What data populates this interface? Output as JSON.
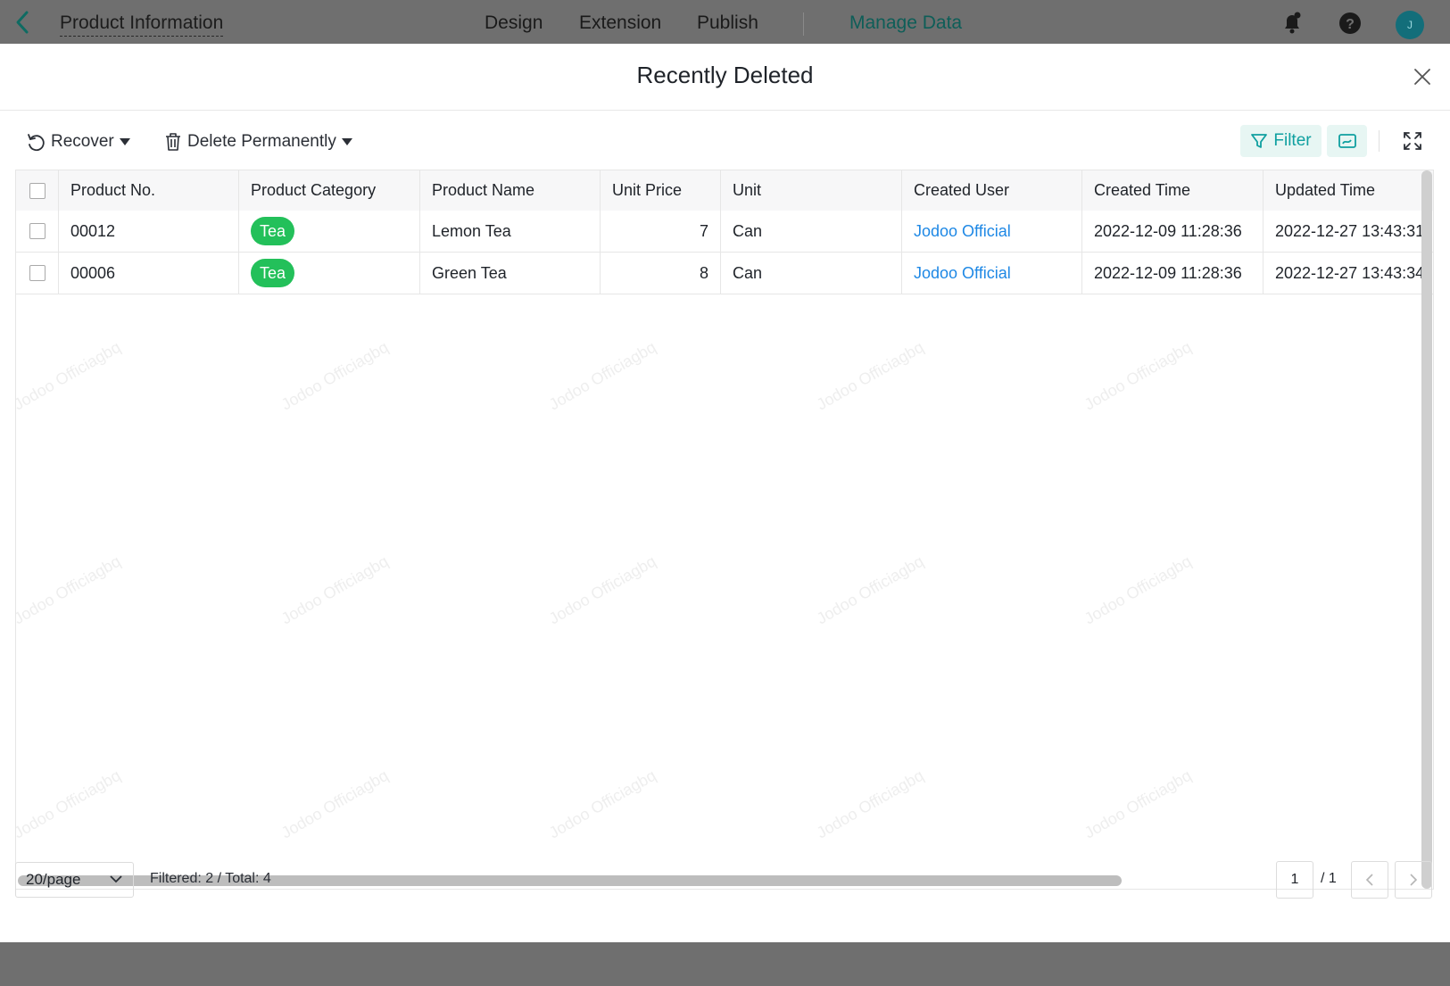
{
  "topbar": {
    "app_title": "Product Information",
    "nav": [
      "Design",
      "Extension",
      "Publish",
      "Manage Data"
    ],
    "active_nav": "Manage Data",
    "avatar_initial": "J"
  },
  "modal": {
    "title": "Recently Deleted"
  },
  "toolbar": {
    "recover_label": "Recover",
    "delete_label": "Delete Permanently",
    "filter_label": "Filter"
  },
  "table": {
    "columns": [
      "Product No.",
      "Product Category",
      "Product Name",
      "Unit Price",
      "Unit",
      "Created User",
      "Created Time",
      "Updated Time"
    ],
    "rows": [
      {
        "no": "00012",
        "category": "Tea",
        "name": "Lemon Tea",
        "price": "7",
        "unit": "Can",
        "user": "Jodoo Official",
        "created": "2022-12-09 11:28:36",
        "updated": "2022-12-27 13:43:31"
      },
      {
        "no": "00006",
        "category": "Tea",
        "name": "Green Tea",
        "price": "8",
        "unit": "Can",
        "user": "Jodoo Official",
        "created": "2022-12-09 11:28:36",
        "updated": "2022-12-27 13:43:34"
      }
    ]
  },
  "watermark_text": "Jodoo Officiagbq",
  "footer": {
    "page_size": "20/page",
    "count_text": "Filtered: 2 / Total: 4",
    "current_page": "1",
    "total_pages": "/ 1"
  },
  "colors": {
    "accent": "#0fa0a0",
    "tag_green": "#23c05a",
    "link_blue": "#1e88e5",
    "topbar_bg": "#6f6f6f"
  }
}
